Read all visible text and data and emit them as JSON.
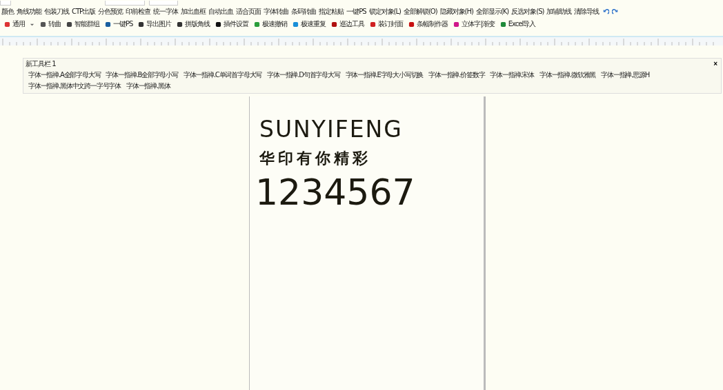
{
  "menu_row": [
    "颜色",
    "角线功能",
    "包装刀线",
    "CTP出版",
    "分色预览",
    "印前检查",
    "统一字体",
    "加出血框",
    "自动出血",
    "适合页面",
    "字体转曲",
    "条码转曲",
    "指定粘贴",
    "一键PS",
    "锁定对象(L)",
    "全部解锁(O)",
    "隐藏对象(H)",
    "全部显示(K)",
    "反选对象(S)",
    "加辅助线",
    "清除导线"
  ],
  "tool_row": [
    {
      "label": "通用",
      "kind": "dropdown"
    },
    {
      "label": "转曲",
      "kind": "button"
    },
    {
      "label": "智能群组",
      "kind": "button"
    },
    {
      "label": "一键PS",
      "kind": "button"
    },
    {
      "label": "导出图片",
      "kind": "button"
    },
    {
      "label": "拼版角线",
      "kind": "button"
    },
    {
      "label": "插件设置",
      "kind": "button"
    },
    {
      "label": "极速撤销",
      "kind": "button"
    },
    {
      "label": "极速重复",
      "kind": "button"
    },
    {
      "label": "巡边工具",
      "kind": "button"
    },
    {
      "label": "装订封面",
      "kind": "button"
    },
    {
      "label": "条幅制作器",
      "kind": "button"
    },
    {
      "label": "立体字|渐变",
      "kind": "button"
    },
    {
      "label": "Excel导入",
      "kind": "button"
    }
  ],
  "floating_toolbar": {
    "title": "新工具栏 1",
    "close": "×",
    "buttons": [
      "字体一指禅.A全部字母大写",
      "字体一指禅.B全部字母小写",
      "字体一指禅.C单词首字母大写",
      "字体一指禅.D句首字母大写",
      "字体一指禅.E字母大小写切换",
      "字体一指禅.价签数字",
      "字体一指禅.宋体",
      "字体一指禅.微软雅黑",
      "字体一指禅.思源H",
      "字体一指禅.黑体中文跨一字号字体",
      "字体一指禅.黑体"
    ]
  },
  "page": {
    "lines": [
      "SUNYIFENG",
      "华印有你精彩",
      "1234567"
    ]
  }
}
